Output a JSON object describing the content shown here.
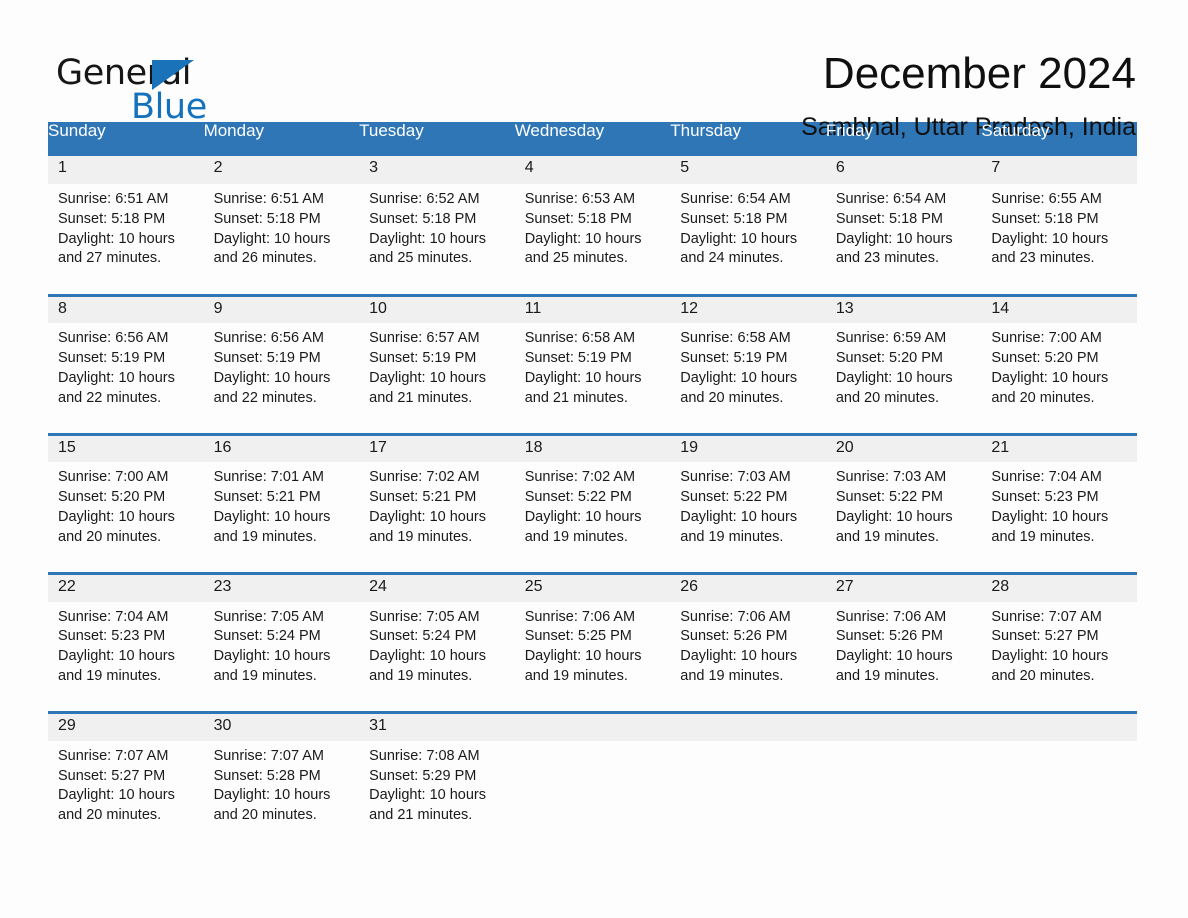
{
  "brand": {
    "name_part1": "General",
    "name_part2": "Blue",
    "triangle_icon": "triangle-icon",
    "blue": "#1472bd"
  },
  "header": {
    "month_title": "December 2024",
    "location": "Sambhal, Uttar Pradesh, India"
  },
  "calendar": {
    "header_bg": "#2f76b6",
    "date_strip_bg": "#f0f0f0",
    "weekday_headers": [
      "Sunday",
      "Monday",
      "Tuesday",
      "Wednesday",
      "Thursday",
      "Friday",
      "Saturday"
    ],
    "weeks": [
      [
        {
          "date": "1",
          "sunrise": "Sunrise: 6:51 AM",
          "sunset": "Sunset: 5:18 PM",
          "daylight_line1": "Daylight: 10 hours",
          "daylight_line2": "and 27 minutes."
        },
        {
          "date": "2",
          "sunrise": "Sunrise: 6:51 AM",
          "sunset": "Sunset: 5:18 PM",
          "daylight_line1": "Daylight: 10 hours",
          "daylight_line2": "and 26 minutes."
        },
        {
          "date": "3",
          "sunrise": "Sunrise: 6:52 AM",
          "sunset": "Sunset: 5:18 PM",
          "daylight_line1": "Daylight: 10 hours",
          "daylight_line2": "and 25 minutes."
        },
        {
          "date": "4",
          "sunrise": "Sunrise: 6:53 AM",
          "sunset": "Sunset: 5:18 PM",
          "daylight_line1": "Daylight: 10 hours",
          "daylight_line2": "and 25 minutes."
        },
        {
          "date": "5",
          "sunrise": "Sunrise: 6:54 AM",
          "sunset": "Sunset: 5:18 PM",
          "daylight_line1": "Daylight: 10 hours",
          "daylight_line2": "and 24 minutes."
        },
        {
          "date": "6",
          "sunrise": "Sunrise: 6:54 AM",
          "sunset": "Sunset: 5:18 PM",
          "daylight_line1": "Daylight: 10 hours",
          "daylight_line2": "and 23 minutes."
        },
        {
          "date": "7",
          "sunrise": "Sunrise: 6:55 AM",
          "sunset": "Sunset: 5:18 PM",
          "daylight_line1": "Daylight: 10 hours",
          "daylight_line2": "and 23 minutes."
        }
      ],
      [
        {
          "date": "8",
          "sunrise": "Sunrise: 6:56 AM",
          "sunset": "Sunset: 5:19 PM",
          "daylight_line1": "Daylight: 10 hours",
          "daylight_line2": "and 22 minutes."
        },
        {
          "date": "9",
          "sunrise": "Sunrise: 6:56 AM",
          "sunset": "Sunset: 5:19 PM",
          "daylight_line1": "Daylight: 10 hours",
          "daylight_line2": "and 22 minutes."
        },
        {
          "date": "10",
          "sunrise": "Sunrise: 6:57 AM",
          "sunset": "Sunset: 5:19 PM",
          "daylight_line1": "Daylight: 10 hours",
          "daylight_line2": "and 21 minutes."
        },
        {
          "date": "11",
          "sunrise": "Sunrise: 6:58 AM",
          "sunset": "Sunset: 5:19 PM",
          "daylight_line1": "Daylight: 10 hours",
          "daylight_line2": "and 21 minutes."
        },
        {
          "date": "12",
          "sunrise": "Sunrise: 6:58 AM",
          "sunset": "Sunset: 5:19 PM",
          "daylight_line1": "Daylight: 10 hours",
          "daylight_line2": "and 20 minutes."
        },
        {
          "date": "13",
          "sunrise": "Sunrise: 6:59 AM",
          "sunset": "Sunset: 5:20 PM",
          "daylight_line1": "Daylight: 10 hours",
          "daylight_line2": "and 20 minutes."
        },
        {
          "date": "14",
          "sunrise": "Sunrise: 7:00 AM",
          "sunset": "Sunset: 5:20 PM",
          "daylight_line1": "Daylight: 10 hours",
          "daylight_line2": "and 20 minutes."
        }
      ],
      [
        {
          "date": "15",
          "sunrise": "Sunrise: 7:00 AM",
          "sunset": "Sunset: 5:20 PM",
          "daylight_line1": "Daylight: 10 hours",
          "daylight_line2": "and 20 minutes."
        },
        {
          "date": "16",
          "sunrise": "Sunrise: 7:01 AM",
          "sunset": "Sunset: 5:21 PM",
          "daylight_line1": "Daylight: 10 hours",
          "daylight_line2": "and 19 minutes."
        },
        {
          "date": "17",
          "sunrise": "Sunrise: 7:02 AM",
          "sunset": "Sunset: 5:21 PM",
          "daylight_line1": "Daylight: 10 hours",
          "daylight_line2": "and 19 minutes."
        },
        {
          "date": "18",
          "sunrise": "Sunrise: 7:02 AM",
          "sunset": "Sunset: 5:22 PM",
          "daylight_line1": "Daylight: 10 hours",
          "daylight_line2": "and 19 minutes."
        },
        {
          "date": "19",
          "sunrise": "Sunrise: 7:03 AM",
          "sunset": "Sunset: 5:22 PM",
          "daylight_line1": "Daylight: 10 hours",
          "daylight_line2": "and 19 minutes."
        },
        {
          "date": "20",
          "sunrise": "Sunrise: 7:03 AM",
          "sunset": "Sunset: 5:22 PM",
          "daylight_line1": "Daylight: 10 hours",
          "daylight_line2": "and 19 minutes."
        },
        {
          "date": "21",
          "sunrise": "Sunrise: 7:04 AM",
          "sunset": "Sunset: 5:23 PM",
          "daylight_line1": "Daylight: 10 hours",
          "daylight_line2": "and 19 minutes."
        }
      ],
      [
        {
          "date": "22",
          "sunrise": "Sunrise: 7:04 AM",
          "sunset": "Sunset: 5:23 PM",
          "daylight_line1": "Daylight: 10 hours",
          "daylight_line2": "and 19 minutes."
        },
        {
          "date": "23",
          "sunrise": "Sunrise: 7:05 AM",
          "sunset": "Sunset: 5:24 PM",
          "daylight_line1": "Daylight: 10 hours",
          "daylight_line2": "and 19 minutes."
        },
        {
          "date": "24",
          "sunrise": "Sunrise: 7:05 AM",
          "sunset": "Sunset: 5:24 PM",
          "daylight_line1": "Daylight: 10 hours",
          "daylight_line2": "and 19 minutes."
        },
        {
          "date": "25",
          "sunrise": "Sunrise: 7:06 AM",
          "sunset": "Sunset: 5:25 PM",
          "daylight_line1": "Daylight: 10 hours",
          "daylight_line2": "and 19 minutes."
        },
        {
          "date": "26",
          "sunrise": "Sunrise: 7:06 AM",
          "sunset": "Sunset: 5:26 PM",
          "daylight_line1": "Daylight: 10 hours",
          "daylight_line2": "and 19 minutes."
        },
        {
          "date": "27",
          "sunrise": "Sunrise: 7:06 AM",
          "sunset": "Sunset: 5:26 PM",
          "daylight_line1": "Daylight: 10 hours",
          "daylight_line2": "and 19 minutes."
        },
        {
          "date": "28",
          "sunrise": "Sunrise: 7:07 AM",
          "sunset": "Sunset: 5:27 PM",
          "daylight_line1": "Daylight: 10 hours",
          "daylight_line2": "and 20 minutes."
        }
      ],
      [
        {
          "date": "29",
          "sunrise": "Sunrise: 7:07 AM",
          "sunset": "Sunset: 5:27 PM",
          "daylight_line1": "Daylight: 10 hours",
          "daylight_line2": "and 20 minutes."
        },
        {
          "date": "30",
          "sunrise": "Sunrise: 7:07 AM",
          "sunset": "Sunset: 5:28 PM",
          "daylight_line1": "Daylight: 10 hours",
          "daylight_line2": "and 20 minutes."
        },
        {
          "date": "31",
          "sunrise": "Sunrise: 7:08 AM",
          "sunset": "Sunset: 5:29 PM",
          "daylight_line1": "Daylight: 10 hours",
          "daylight_line2": "and 21 minutes."
        },
        {
          "date": "",
          "sunrise": "",
          "sunset": "",
          "daylight_line1": "",
          "daylight_line2": ""
        },
        {
          "date": "",
          "sunrise": "",
          "sunset": "",
          "daylight_line1": "",
          "daylight_line2": ""
        },
        {
          "date": "",
          "sunrise": "",
          "sunset": "",
          "daylight_line1": "",
          "daylight_line2": ""
        },
        {
          "date": "",
          "sunrise": "",
          "sunset": "",
          "daylight_line1": "",
          "daylight_line2": ""
        }
      ]
    ]
  }
}
